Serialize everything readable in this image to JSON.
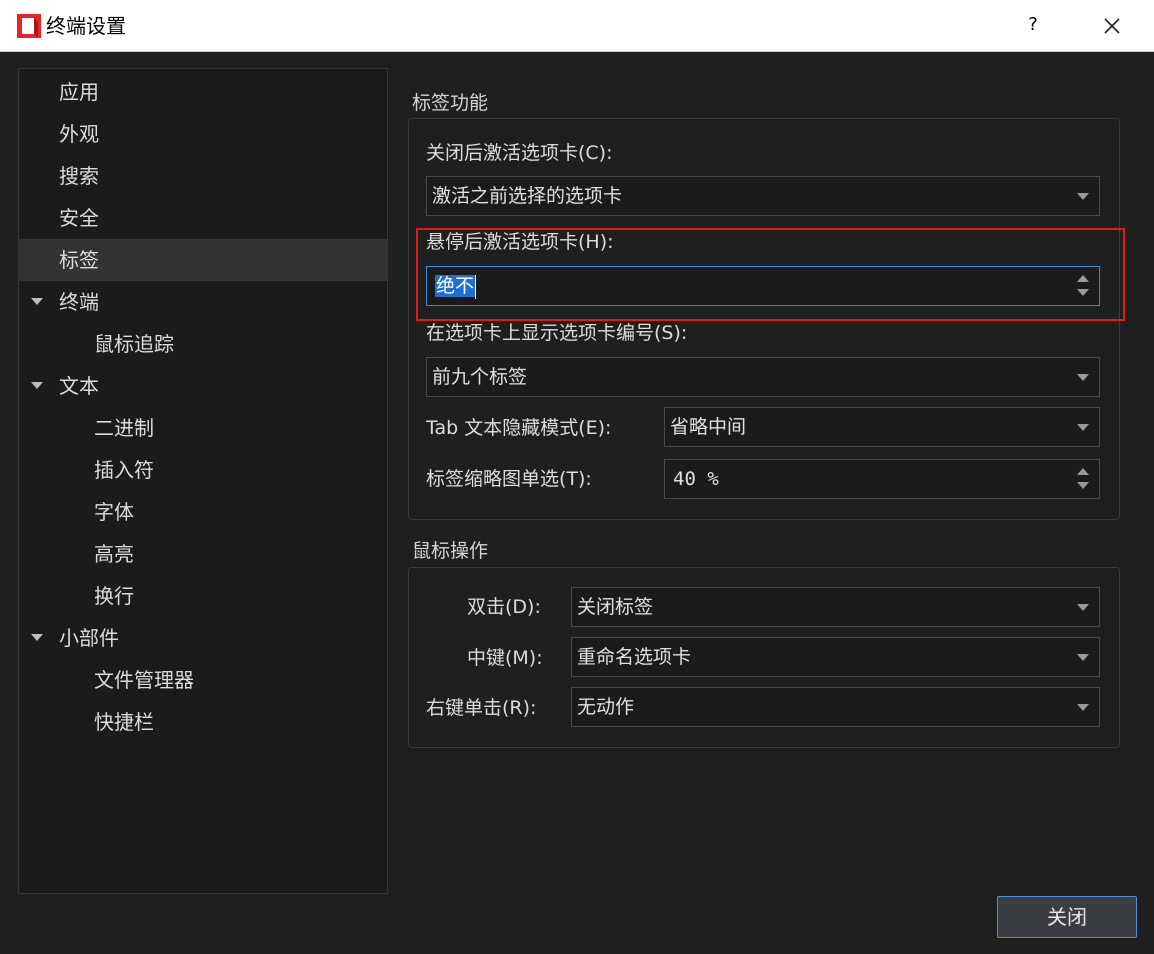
{
  "window": {
    "title": "终端设置",
    "help_label": "?"
  },
  "nav": {
    "items": [
      {
        "label": "应用"
      },
      {
        "label": "外观"
      },
      {
        "label": "搜索"
      },
      {
        "label": "安全"
      },
      {
        "label": "标签"
      },
      {
        "label": "终端"
      },
      {
        "label": "鼠标追踪"
      },
      {
        "label": "文本"
      },
      {
        "label": "二进制"
      },
      {
        "label": "插入符"
      },
      {
        "label": "字体"
      },
      {
        "label": "高亮"
      },
      {
        "label": "换行"
      },
      {
        "label": "小部件"
      },
      {
        "label": "文件管理器"
      },
      {
        "label": "快捷栏"
      }
    ],
    "selected": "标签"
  },
  "tab_features": {
    "title": "标签功能",
    "activate_after_close": {
      "label": "关闭后激活选项卡(C):",
      "value": "激活之前选择的选项卡"
    },
    "activate_on_hover": {
      "label": "悬停后激活选项卡(H):",
      "value": "绝不"
    },
    "show_tab_number": {
      "label": "在选项卡上显示选项卡编号(S):",
      "value": "前九个标签"
    },
    "text_elide_mode": {
      "label": "Tab 文本隐藏模式(E):",
      "value": "省略中间"
    },
    "thumbnail_scale": {
      "label": "标签缩略图单选(T):",
      "value": "40 %"
    }
  },
  "mouse_actions": {
    "title": "鼠标操作",
    "double_click": {
      "label": "双击(D):",
      "value": "关闭标签"
    },
    "middle_click": {
      "label": "中键(M):",
      "value": "重命名选项卡"
    },
    "right_click": {
      "label": "右键单击(R):",
      "value": "无动作"
    }
  },
  "footer": {
    "close_label": "关闭"
  },
  "colors": {
    "accent": "#1e6fd0",
    "focus_border": "#2f8be0",
    "annotation": "#e01b1b",
    "background": "#1f1f1f"
  }
}
